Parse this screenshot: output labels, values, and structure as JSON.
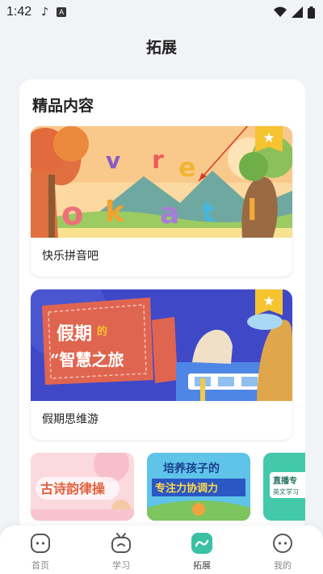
{
  "status": {
    "time": "1:42",
    "music_icon": "music-note-icon",
    "a_badge": "A",
    "icons": [
      "wifi-icon",
      "signal-icon",
      "battery-icon"
    ]
  },
  "header": {
    "title": "拓展"
  },
  "section": {
    "title": "精品内容"
  },
  "cards": [
    {
      "label": "快乐拼音吧",
      "image_letters": [
        "v",
        "r",
        "e",
        "o",
        "k",
        "a",
        "t",
        "l"
      ],
      "badge_icon": "star-icon"
    },
    {
      "label": "假期思维游",
      "image_text_1": "假期",
      "image_text_2": "的",
      "image_text_3": "“智慧之旅",
      "badge_icon": "star-icon"
    }
  ],
  "thumbnails": [
    {
      "text": "古诗韵律操"
    },
    {
      "text_1": "培养孩子的",
      "text_2": "专注力协调力"
    },
    {
      "text_1": "直播专",
      "text_2": "英文学习"
    }
  ],
  "nav": {
    "items": [
      {
        "label": "首页",
        "icon": "home-face-icon",
        "active": false
      },
      {
        "label": "学习",
        "icon": "tv-study-icon",
        "active": false
      },
      {
        "label": "拓展",
        "icon": "expand-wave-icon",
        "active": true
      },
      {
        "label": "我的",
        "icon": "profile-face-icon",
        "active": false
      }
    ]
  },
  "colors": {
    "accent": "#3ac0a3",
    "badge": "#f6c331",
    "card2_bg": "#3f49c7",
    "ticket": "#e06550"
  }
}
